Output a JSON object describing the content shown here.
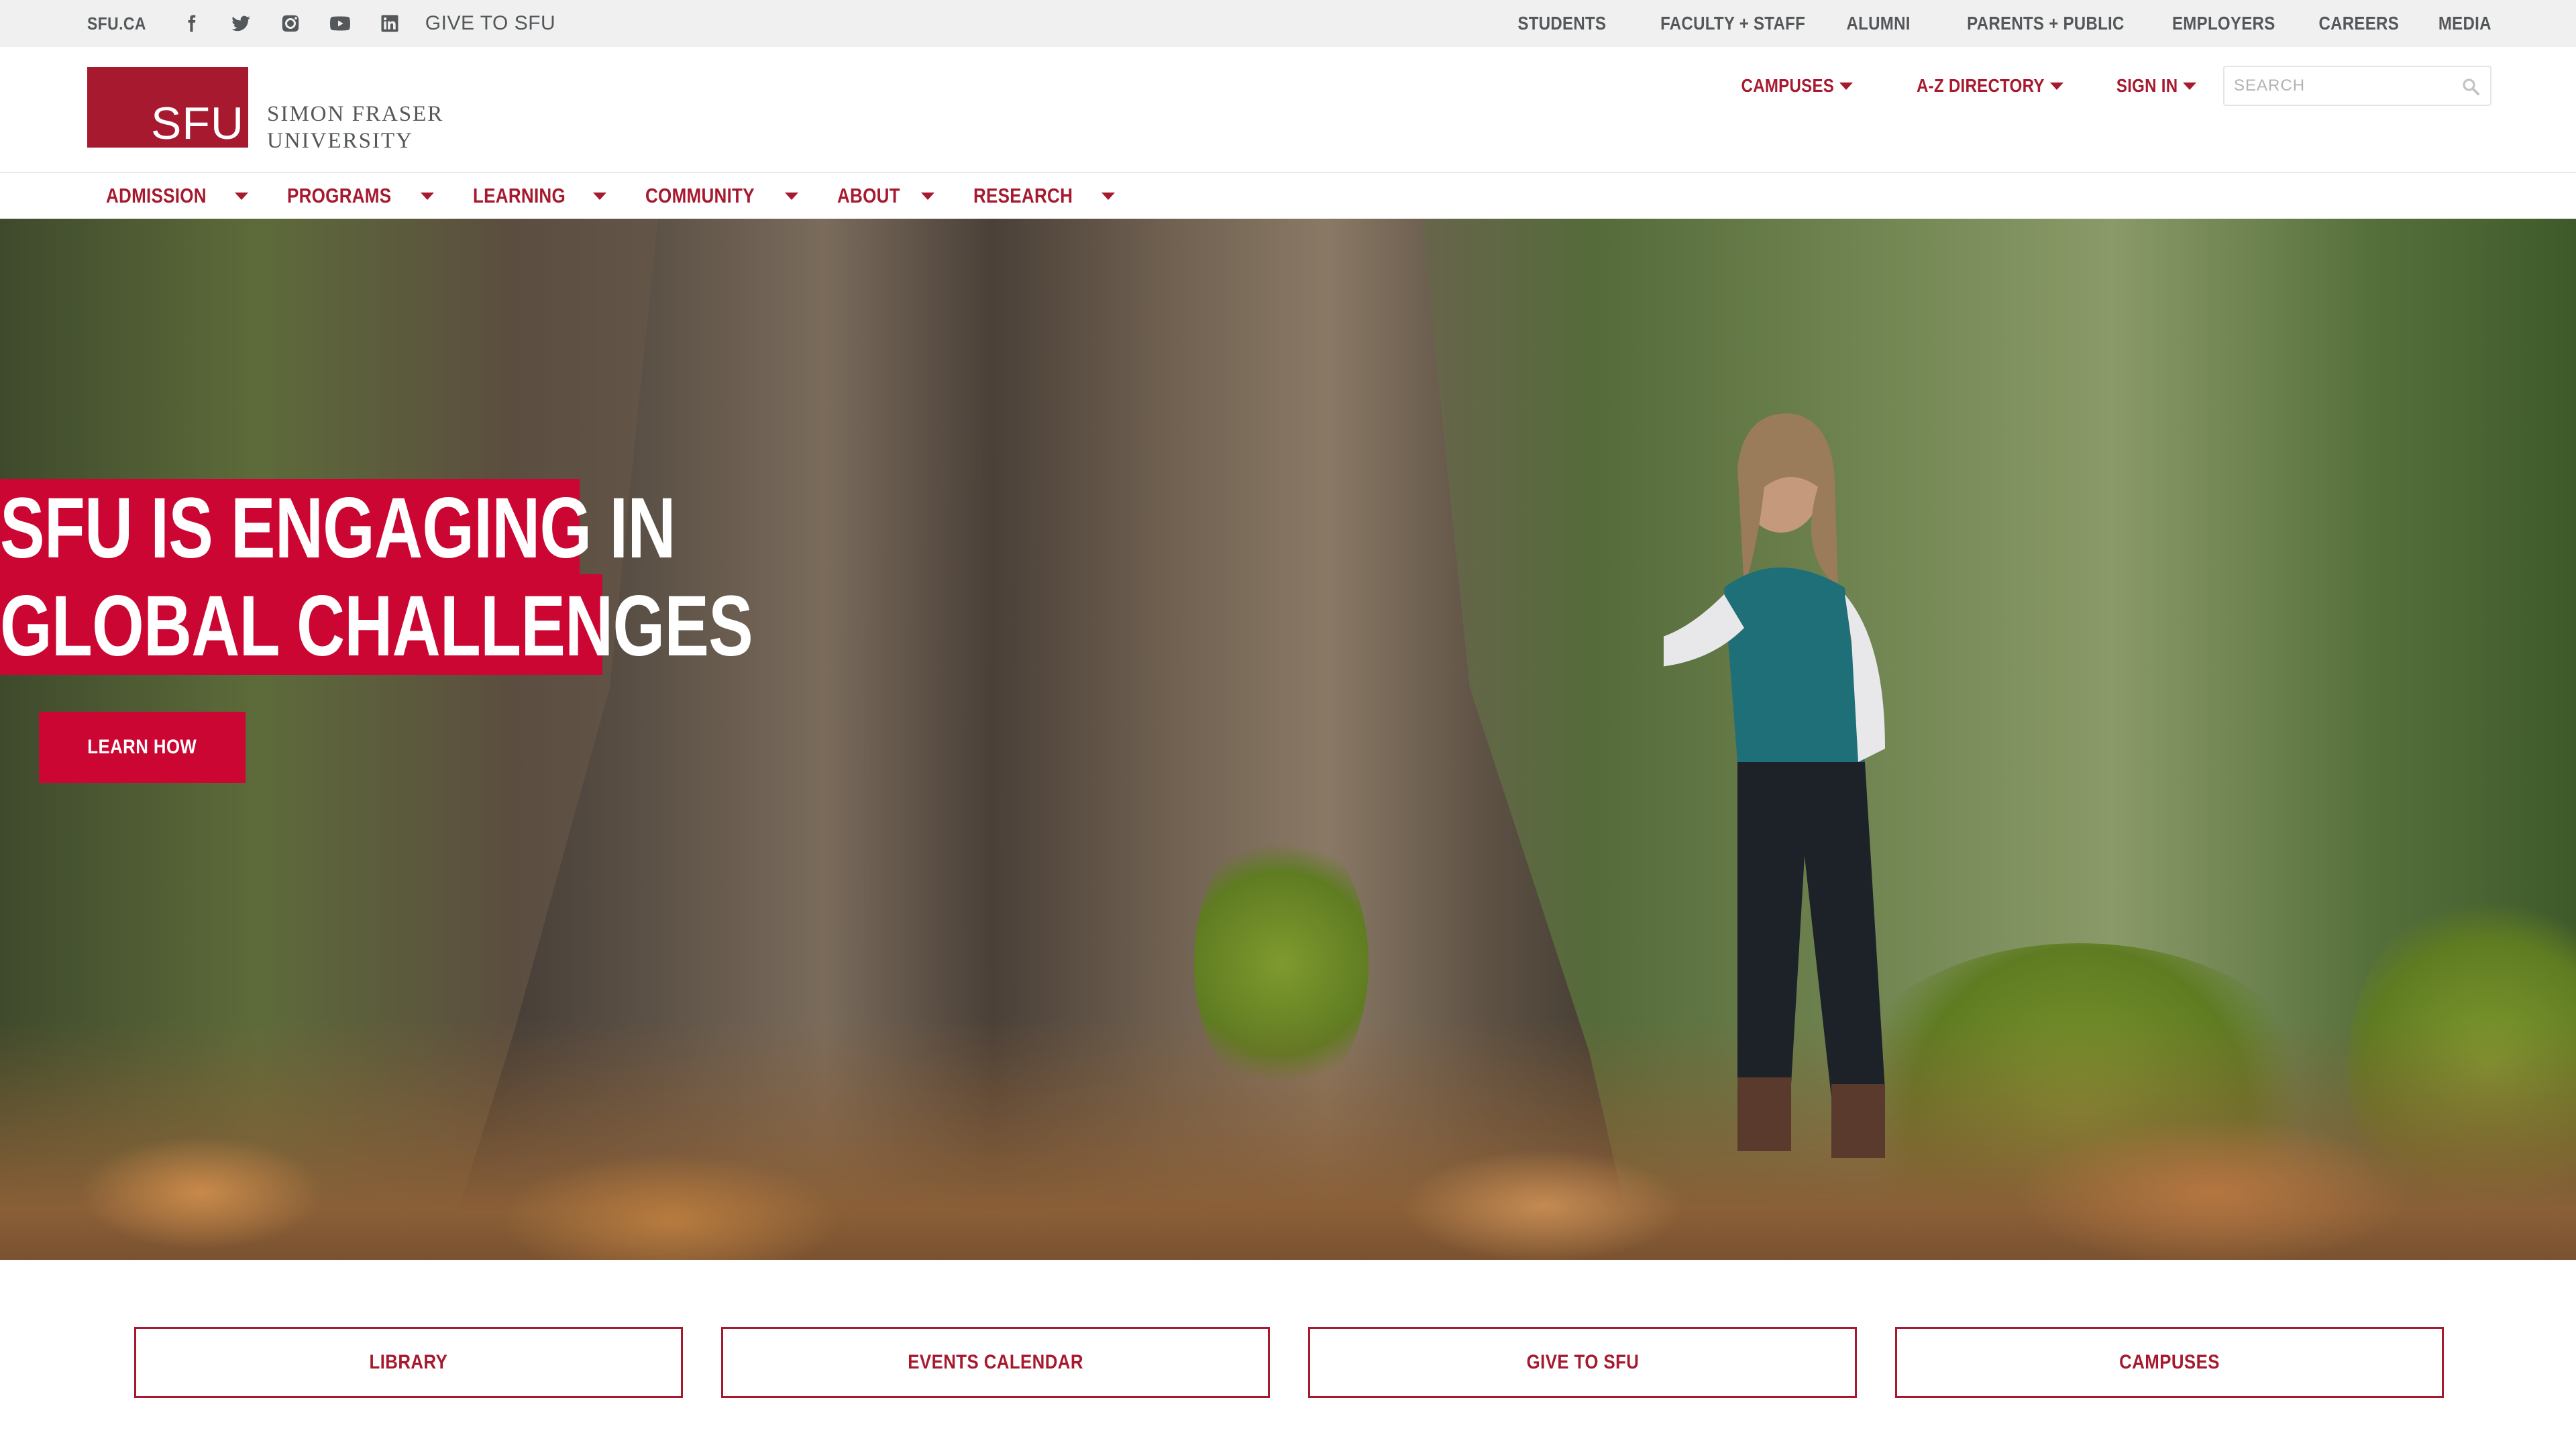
{
  "utility": {
    "site_link": "SFU.CA",
    "social_icons": [
      "facebook-icon",
      "twitter-icon",
      "instagram-icon",
      "youtube-icon",
      "linkedin-icon"
    ],
    "give_link": "GIVE TO SFU",
    "audience_links": [
      "STUDENTS",
      "FACULTY + STAFF",
      "ALUMNI",
      "PARENTS + PUBLIC",
      "EMPLOYERS",
      "CAREERS",
      "MEDIA"
    ]
  },
  "header": {
    "logo_mark": "SFU",
    "logo_name_line1": "SIMON FRASER",
    "logo_name_line2": "UNIVERSITY",
    "links": [
      "CAMPUSES",
      "A-Z DIRECTORY",
      "SIGN IN"
    ],
    "search_placeholder": "SEARCH"
  },
  "nav": {
    "items": [
      "ADMISSION",
      "PROGRAMS",
      "LEARNING",
      "COMMUNITY",
      "ABOUT",
      "RESEARCH"
    ]
  },
  "hero": {
    "title_line1": "SFU IS ENGAGING IN",
    "title_line2": "GLOBAL CHALLENGES",
    "cta_label": "LEARN HOW"
  },
  "quick_links": [
    "LIBRARY",
    "EVENTS CALENDAR",
    "GIVE TO SFU",
    "CAMPUSES"
  ],
  "colors": {
    "brand_red": "#a6192e",
    "hero_red": "#cc0633",
    "utility_gray": "#54585a"
  }
}
